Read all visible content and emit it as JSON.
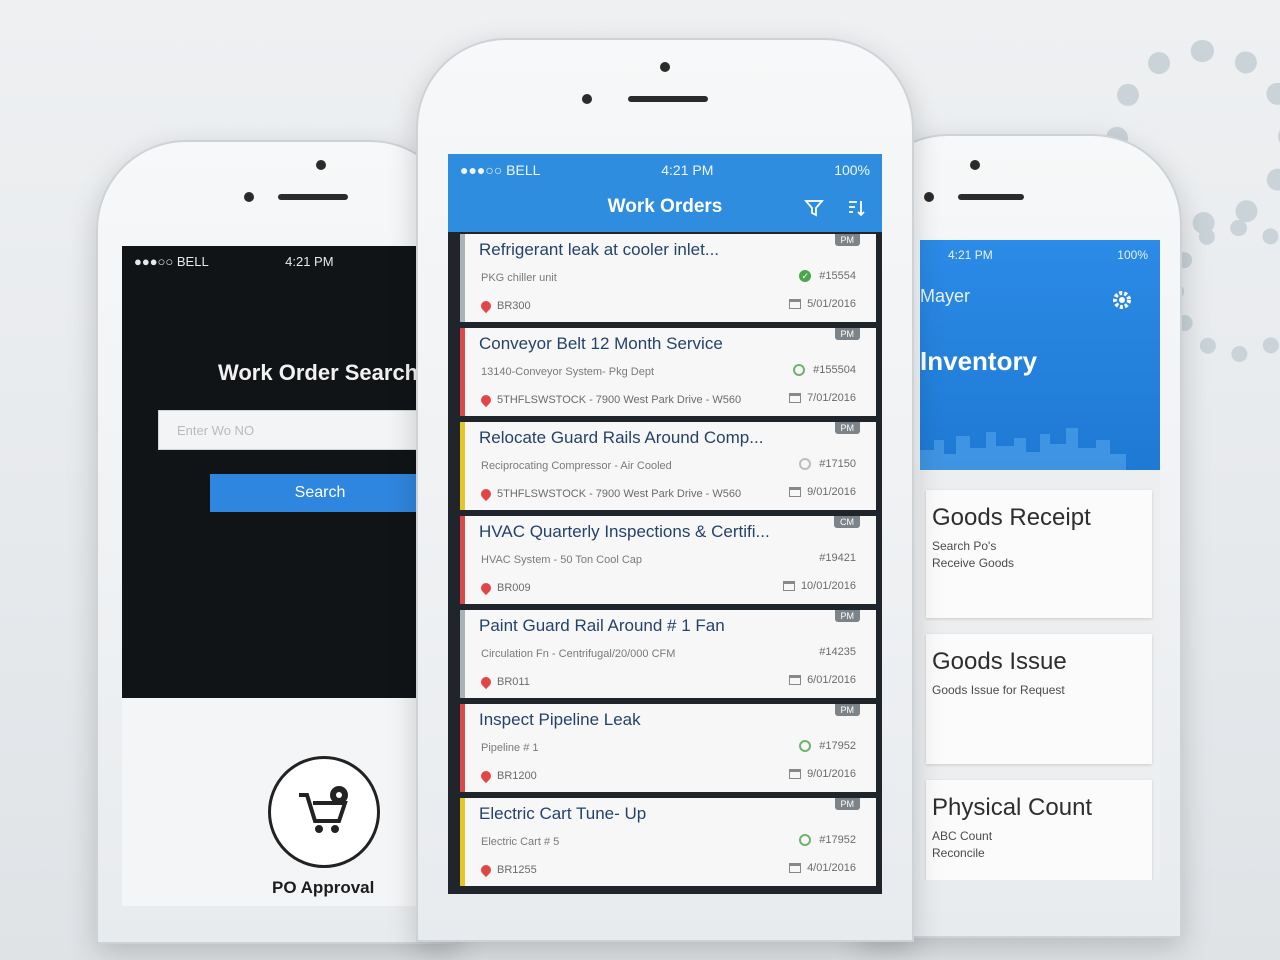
{
  "left_phone": {
    "status": {
      "carrier": "●●●○○ BELL",
      "time": "4:21 PM"
    },
    "title": "Work Order Search",
    "input_placeholder": "Enter Wo NO",
    "search_button": "Search",
    "po_label": "PO Approval"
  },
  "center_phone": {
    "status": {
      "carrier": "●●●○○ BELL",
      "time": "4:21 PM",
      "battery": "100%"
    },
    "title": "Work Orders",
    "work_orders": [
      {
        "title": "Refrigerant leak at cooler inlet...",
        "asset": "PKG chiller unit",
        "location": "BR300",
        "number": "#15554",
        "date": "5/01/2016",
        "badge": "PM",
        "status_icon": "check-icon",
        "priority": "none"
      },
      {
        "title": "Conveyor Belt 12 Month Service",
        "asset": "13140-Conveyor System- Pkg Dept",
        "location": "5THFLSWSTOCK - 7900 West Park Drive - W560",
        "number": "#155504",
        "date": "7/01/2016",
        "badge": "PM",
        "status_icon": "progress-icon",
        "priority": "red"
      },
      {
        "title": "Relocate Guard Rails Around Comp...",
        "asset": "Reciprocating Compressor - Air Cooled",
        "location": "5THFLSWSTOCK - 7900 West Park Drive - W560",
        "number": "#17150",
        "date": "9/01/2016",
        "badge": "PM",
        "status_icon": "pending-icon",
        "priority": "yellow"
      },
      {
        "title": "HVAC Quarterly Inspections & Certifi...",
        "asset": "HVAC System - 50 Ton Cool Cap",
        "location": "BR009",
        "number": "#19421",
        "date": "10/01/2016",
        "badge": "CM",
        "status_icon": "",
        "priority": "red"
      },
      {
        "title": "Paint Guard Rail Around # 1 Fan",
        "asset": "Circulation Fn - Centrifugal/20/000 CFM",
        "location": "BR011",
        "number": "#14235",
        "date": "6/01/2016",
        "badge": "PM",
        "status_icon": "",
        "priority": "none"
      },
      {
        "title": "Inspect Pipeline Leak",
        "asset": "Pipeline # 1",
        "location": "BR1200",
        "number": "#17952",
        "date": "9/01/2016",
        "badge": "PM",
        "status_icon": "progress-icon",
        "priority": "red"
      },
      {
        "title": "Electric Cart Tune- Up",
        "asset": "Electric Cart # 5",
        "location": "BR1255",
        "number": "#17952",
        "date": "4/01/2016",
        "badge": "PM",
        "status_icon": "progress-icon",
        "priority": "yellow"
      }
    ]
  },
  "right_phone": {
    "status": {
      "time": "4:21 PM",
      "battery": "100%"
    },
    "user": "Mayer",
    "section_title": "Inventory",
    "cards": [
      {
        "title": "Goods Receipt",
        "line1": "Search Po's",
        "line2": "Receive Goods"
      },
      {
        "title": "Goods Issue",
        "line1": "Goods Issue for Request",
        "line2": ""
      },
      {
        "title": "Physical Count",
        "line1": "ABC Count",
        "line2": "Reconcile"
      }
    ]
  },
  "colors": {
    "accent": "#2f8de0",
    "priority_red": "#d84a4a",
    "priority_yellow": "#e6c527"
  }
}
